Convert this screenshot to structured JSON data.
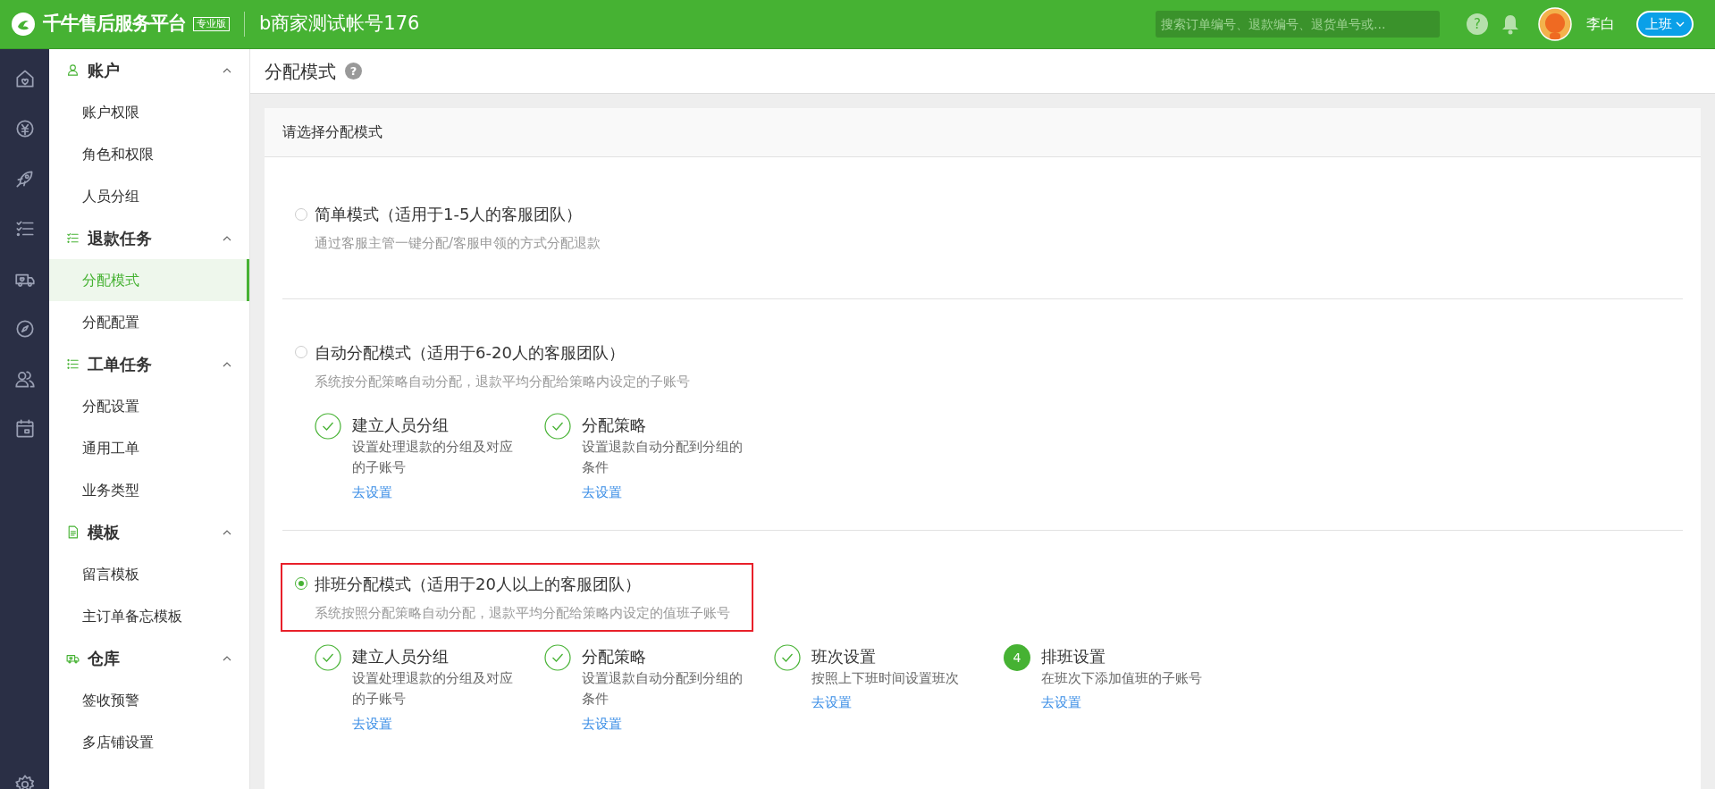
{
  "topbar": {
    "help": "?",
    "brand": "千牛售后服务平台",
    "edition": "专业版",
    "account": "b商家测试帐号176",
    "search": {
      "placeholder": "搜索订单编号、退款编号、退货单号或..."
    },
    "user": "李白",
    "status_button": "上班"
  },
  "sidebar": {
    "groups": [
      {
        "title": "账户",
        "expanded": true,
        "items": [
          {
            "label": "账户权限",
            "selected": false
          },
          {
            "label": "角色和权限",
            "selected": false
          },
          {
            "label": "人员分组",
            "selected": false
          }
        ]
      },
      {
        "title": "退款任务",
        "expanded": true,
        "items": [
          {
            "label": "分配模式",
            "selected": true
          },
          {
            "label": "分配配置",
            "selected": false
          }
        ]
      },
      {
        "title": "工单任务",
        "expanded": true,
        "items": [
          {
            "label": "分配设置",
            "selected": false
          },
          {
            "label": "通用工单",
            "selected": false
          },
          {
            "label": "业务类型",
            "selected": false
          }
        ]
      },
      {
        "title": "模板",
        "expanded": true,
        "items": [
          {
            "label": "留言模板",
            "selected": false
          },
          {
            "label": "主订单备忘模板",
            "selected": false
          }
        ]
      },
      {
        "title": "仓库",
        "expanded": true,
        "items": [
          {
            "label": "签收预警",
            "selected": false
          },
          {
            "label": "多店铺设置",
            "selected": false
          }
        ]
      }
    ]
  },
  "page": {
    "title": "分配模式",
    "help": "?",
    "card_title": "请选择分配模式",
    "options": [
      {
        "title": "简单模式（适用于1-5人的客服团队）",
        "description": "通过客服主管一键分配/客服申领的方式分配退款",
        "selected": false,
        "highlighted": false
      },
      {
        "title": "自动分配模式（适用于6-20人的客服团队）",
        "description": "系统按分配策略自动分配，退款平均分配给策略内设定的子账号",
        "selected": false,
        "highlighted": false,
        "steps": [
          {
            "kind": "done",
            "title": "建立人员分组",
            "description": "设置处理退款的分组及对应的子账号",
            "link": "去设置"
          },
          {
            "kind": "done",
            "title": "分配策略",
            "description": "设置退款自动分配到分组的条件",
            "link": "去设置"
          }
        ]
      },
      {
        "title": "排班分配模式（适用于20人以上的客服团队）",
        "description": "系统按照分配策略自动分配，退款平均分配给策略内设定的值班子账号",
        "selected": true,
        "highlighted": true,
        "steps": [
          {
            "kind": "done",
            "title": "建立人员分组",
            "description": "设置处理退款的分组及对应的子账号",
            "link": "去设置"
          },
          {
            "kind": "done",
            "title": "分配策略",
            "description": "设置退款自动分配到分组的条件",
            "link": "去设置"
          },
          {
            "kind": "done",
            "title": "班次设置",
            "description": "按照上下班时间设置班次",
            "link": "去设置"
          },
          {
            "kind": "number",
            "number": "4",
            "title": "排班设置",
            "description": "在班次下添加值班的子账号",
            "link": "去设置"
          }
        ]
      }
    ]
  }
}
